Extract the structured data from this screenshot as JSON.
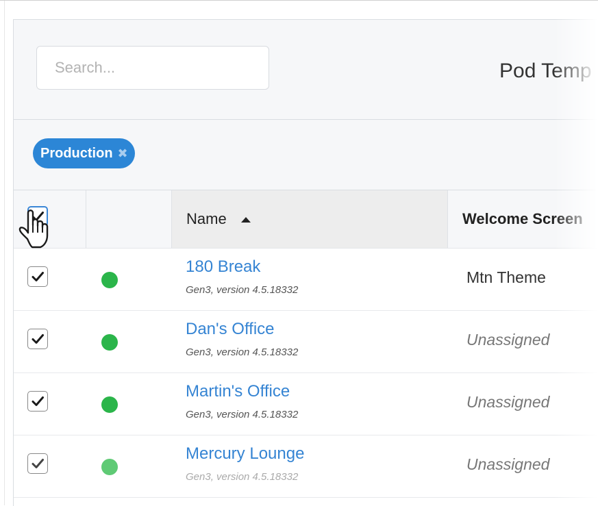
{
  "search": {
    "placeholder": "Search..."
  },
  "page_title": "Pod Temp",
  "filters": [
    {
      "label": "Production",
      "remove_icon": "close-icon"
    }
  ],
  "table": {
    "header_checkbox_checked": true,
    "columns": [
      {
        "key": "select",
        "label": ""
      },
      {
        "key": "status",
        "label": ""
      },
      {
        "key": "name",
        "label": "Name",
        "sort": "asc"
      },
      {
        "key": "welcome_screen",
        "label": "Welcome Screen"
      }
    ],
    "rows": [
      {
        "checked": true,
        "status": "online",
        "name": "180 Break",
        "subtitle": "Gen3, version 4.5.18332",
        "welcome_screen": "Mtn Theme"
      },
      {
        "checked": true,
        "status": "online",
        "name": "Dan's Office",
        "subtitle": "Gen3, version 4.5.18332",
        "welcome_screen": "Unassigned"
      },
      {
        "checked": true,
        "status": "online",
        "name": "Martin's Office",
        "subtitle": "Gen3, version 4.5.18332",
        "welcome_screen": "Unassigned"
      },
      {
        "checked": true,
        "status": "online",
        "name": "Mercury Lounge",
        "subtitle": "Gen3, version 4.5.18332",
        "welcome_screen": "Unassigned"
      }
    ]
  },
  "colors": {
    "accent": "#2c86d6",
    "link": "#3584d3",
    "status_online": "#2bb54a",
    "header_bg": "#f6f7f9"
  },
  "cursor": "hand-pointer-cursor-icon"
}
